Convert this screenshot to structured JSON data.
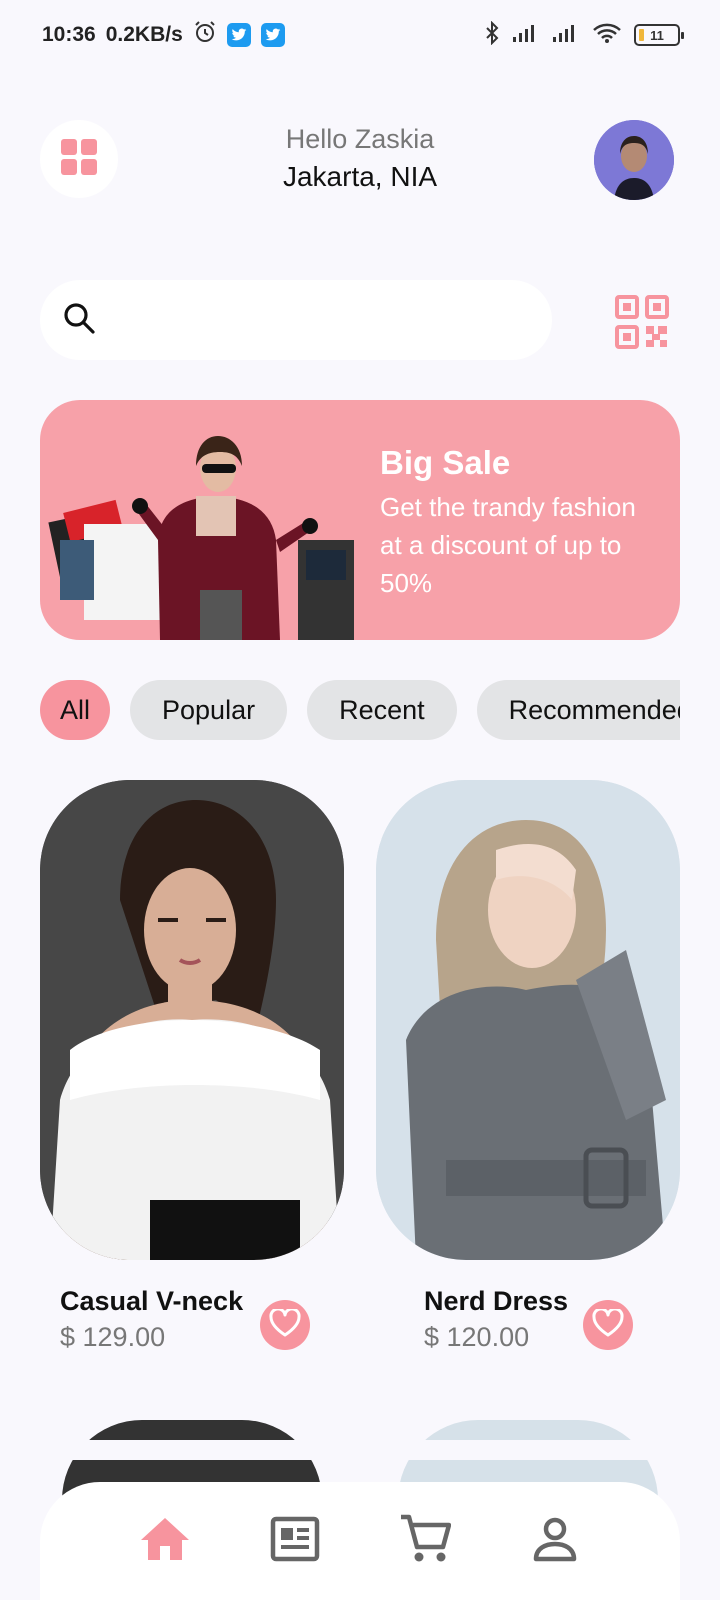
{
  "status_bar": {
    "time": "10:36",
    "speed": "0.2KB/s",
    "battery": "11"
  },
  "header": {
    "greeting": "Hello Zaskia",
    "location": "Jakarta, NIA"
  },
  "search": {
    "placeholder": ""
  },
  "banner": {
    "title": "Big Sale",
    "description": "Get the trandy fashion at a discount of up to 50%"
  },
  "tabs": [
    {
      "label": "All",
      "active": true
    },
    {
      "label": "Popular",
      "active": false
    },
    {
      "label": "Recent",
      "active": false
    },
    {
      "label": "Recommended",
      "active": false
    }
  ],
  "products": [
    {
      "name": "Casual V-neck",
      "price": "$ 129.00"
    },
    {
      "name": "Nerd Dress",
      "price": "$ 120.00"
    }
  ],
  "colors": {
    "accent": "#f7949e",
    "banner": "#f7a1a9",
    "background": "#f9f8fd"
  },
  "icons": {
    "menu": "grid-icon",
    "search": "search-icon",
    "qr": "qr-code-icon",
    "favorite": "heart-icon",
    "nav": [
      "home-icon",
      "news-icon",
      "cart-icon",
      "profile-icon"
    ]
  }
}
